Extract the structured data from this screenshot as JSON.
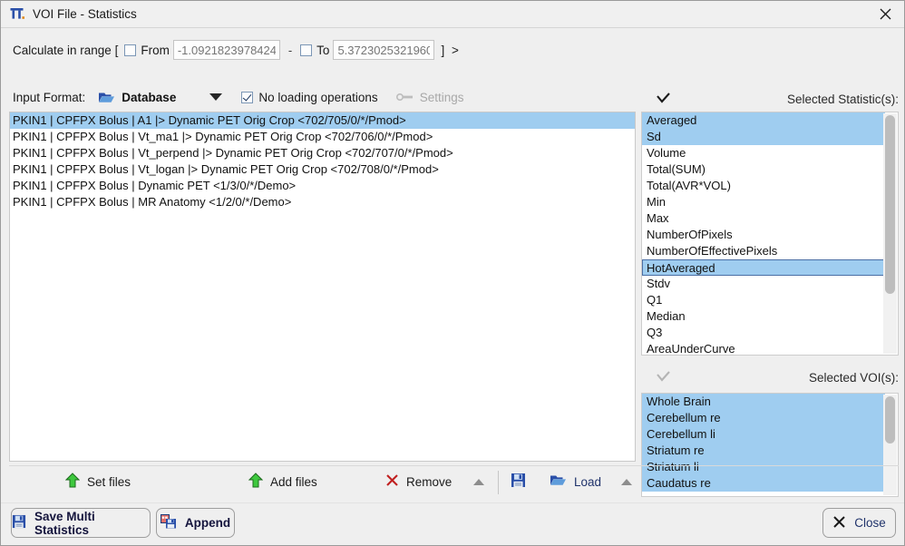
{
  "window": {
    "title": "VOI File - Statistics",
    "icon": "pmod-logo-icon",
    "close_icon": "close-icon"
  },
  "range": {
    "label": "Calculate in range [",
    "from_label": "From",
    "from_value": "",
    "from_placeholder": "-1.09218239784240",
    "from_checked": false,
    "dash": "-",
    "to_label": "To",
    "to_value": "",
    "to_placeholder": "5.37230253219604",
    "to_checked": false,
    "end_bracket": "] >"
  },
  "input_format": {
    "label": "Input Format:",
    "value": "Database",
    "folder_icon": "folder-open-icon",
    "dropdown_icon": "chevron-down-icon",
    "no_loading_label": "No loading operations",
    "no_loading_checked": true,
    "settings_label": "Settings",
    "settings_icon": "wrench-icon",
    "settings_enabled": false
  },
  "file_list": {
    "items": [
      {
        "text": "PKIN1 | CPFPX Bolus | A1 |> Dynamic PET Orig Crop <702/705/0/*/Pmod>",
        "selected": true
      },
      {
        "text": "PKIN1 | CPFPX Bolus | Vt_ma1 |> Dynamic PET Orig Crop <702/706/0/*/Pmod>",
        "selected": false
      },
      {
        "text": "PKIN1 | CPFPX Bolus | Vt_perpend |> Dynamic PET Orig Crop <702/707/0/*/Pmod>",
        "selected": false
      },
      {
        "text": "PKIN1 | CPFPX Bolus | Vt_logan |> Dynamic PET Orig Crop <702/708/0/*/Pmod>",
        "selected": false
      },
      {
        "text": "PKIN1 | CPFPX Bolus | Dynamic PET <1/3/0/*/Demo>",
        "selected": false
      },
      {
        "text": "PKIN1 | CPFPX Bolus | MR Anatomy <1/2/0/*/Demo>",
        "selected": false
      }
    ]
  },
  "statistics": {
    "header_label": "Selected Statistic(s):",
    "header_icon": "checkmark-icon",
    "items": [
      {
        "text": "Averaged",
        "selected": true,
        "focused": false
      },
      {
        "text": "Sd",
        "selected": true,
        "focused": false
      },
      {
        "text": "Volume",
        "selected": false,
        "focused": false
      },
      {
        "text": "Total(SUM)",
        "selected": false,
        "focused": false
      },
      {
        "text": "Total(AVR*VOL)",
        "selected": false,
        "focused": false
      },
      {
        "text": "Min",
        "selected": false,
        "focused": false
      },
      {
        "text": "Max",
        "selected": false,
        "focused": false
      },
      {
        "text": "NumberOfPixels",
        "selected": false,
        "focused": false
      },
      {
        "text": "NumberOfEffectivePixels",
        "selected": false,
        "focused": false
      },
      {
        "text": "HotAveraged",
        "selected": true,
        "focused": true
      },
      {
        "text": "Stdv",
        "selected": false,
        "focused": false
      },
      {
        "text": "Q1",
        "selected": false,
        "focused": false
      },
      {
        "text": "Median",
        "selected": false,
        "focused": false
      },
      {
        "text": "Q3",
        "selected": false,
        "focused": false
      },
      {
        "text": "AreaUnderCurve",
        "selected": false,
        "focused": false
      }
    ]
  },
  "vois": {
    "header_label": "Selected VOI(s):",
    "header_icon": "checkmark-icon",
    "items": [
      {
        "text": "Whole Brain",
        "selected": true
      },
      {
        "text": "Cerebellum re",
        "selected": true
      },
      {
        "text": "Cerebellum li",
        "selected": true
      },
      {
        "text": "Striatum re",
        "selected": true
      },
      {
        "text": "Striatum li",
        "selected": true
      },
      {
        "text": "Caudatus re",
        "selected": true
      }
    ]
  },
  "toolbar": {
    "set_files_label": "Set files",
    "set_files_icon": "green-up-arrow-icon",
    "add_files_label": "Add files",
    "add_files_icon": "green-up-arrow-icon",
    "remove_label": "Remove",
    "remove_icon": "red-x-icon",
    "remove_more_icon": "triangle-up-icon",
    "save_icon": "floppy-disk-icon",
    "load_label": "Load",
    "load_icon": "folder-open-icon",
    "load_more_icon": "triangle-up-icon"
  },
  "buttons": {
    "save_multi_label": "Save Multi Statistics",
    "save_multi_icon": "floppy-disk-icon",
    "append_label": "Append",
    "append_icon": "append-windows-icon",
    "close_label": "Close",
    "close_icon": "x-icon"
  },
  "colors": {
    "selection_blue": "#9fcdf0",
    "dialog_bg": "#efefef",
    "list_bg": "#ffffff",
    "accent_green": "#3ec83e",
    "accent_red": "#c02020",
    "accent_blue": "#2a4fa8"
  }
}
